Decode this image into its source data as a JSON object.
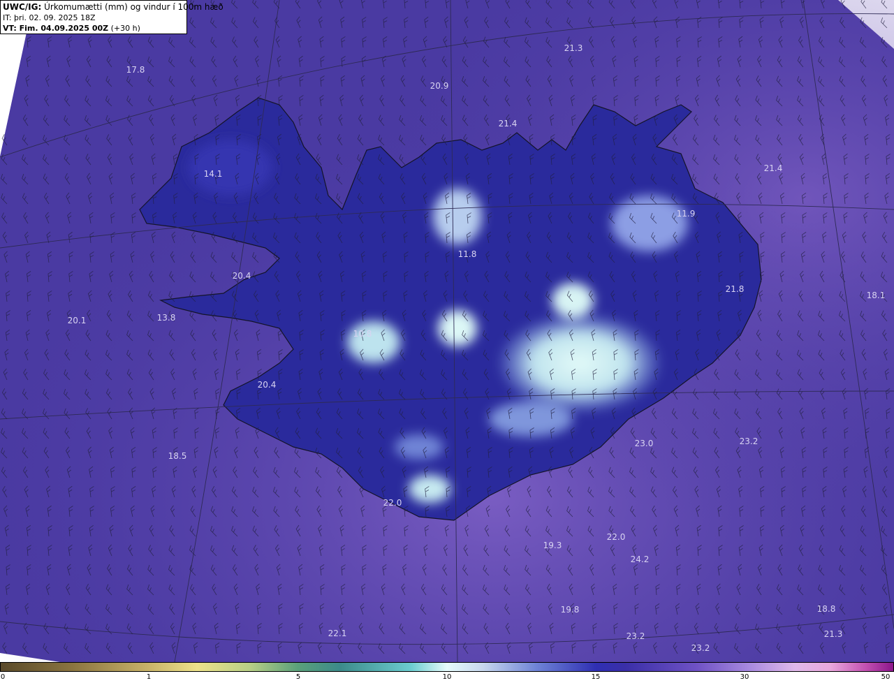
{
  "header": {
    "product": "UWC/IG:",
    "title": "Úrkomumætti (mm) og vindur í 100m hæð",
    "issue_time": "IT: þri. 02. 09. 2025 18Z",
    "valid_prefix": "VT: Fim. 04.09.2025 00Z",
    "valid_suffix": "(+30 h)"
  },
  "colorbar": {
    "ticks": [
      "0",
      "1",
      "5",
      "10",
      "15",
      "30",
      "50"
    ]
  },
  "colors": {
    "background": "#4b3aa3",
    "ocean_light": "#7b5fc4",
    "land_dark": "#2b2a9a",
    "heavy": "#cfeff2",
    "coast": "#1a1a2a"
  },
  "map_labels": [
    {
      "text": "17.8"
    },
    {
      "text": "21.3"
    },
    {
      "text": "20.9"
    },
    {
      "text": "21.4"
    },
    {
      "text": "21.4"
    },
    {
      "text": "14.1"
    },
    {
      "text": "11.9"
    },
    {
      "text": "11.8"
    },
    {
      "text": "20.4"
    },
    {
      "text": "21.8"
    },
    {
      "text": "18.1"
    },
    {
      "text": "20.1"
    },
    {
      "text": "13.8"
    },
    {
      "text": "10.8"
    },
    {
      "text": "20.4"
    },
    {
      "text": "23.0"
    },
    {
      "text": "23.2"
    },
    {
      "text": "18.5"
    },
    {
      "text": "22.0"
    },
    {
      "text": "19.3"
    },
    {
      "text": "22.0"
    },
    {
      "text": "24.2"
    },
    {
      "text": "19.8"
    },
    {
      "text": "18.8"
    },
    {
      "text": "22.1"
    },
    {
      "text": "23.2"
    },
    {
      "text": "21.3"
    },
    {
      "text": "23.2"
    }
  ]
}
